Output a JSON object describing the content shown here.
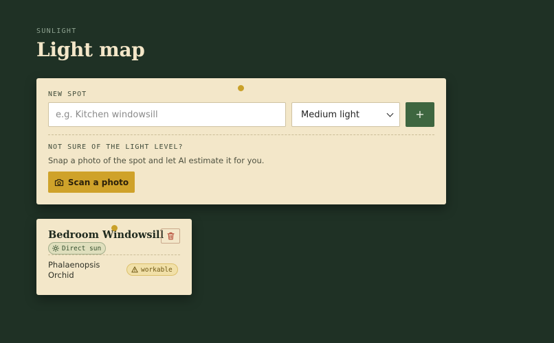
{
  "header": {
    "eyebrow": "SUNLIGHT",
    "title": "Light map"
  },
  "new_spot": {
    "label": "NEW SPOT",
    "name_placeholder": "e.g. Kitchen windowsill",
    "name_value": "",
    "light_level_selected": "Medium light",
    "add_label": "+",
    "helper_heading": "NOT SURE OF THE LIGHT LEVEL?",
    "helper_text": "Snap a photo of the spot and let AI estimate it for you.",
    "scan_label": "Scan a photo"
  },
  "spots": [
    {
      "name": "Bedroom Windowsill",
      "light": "Direct sun",
      "plants": [
        {
          "name": "Phalaenopsis Orchid",
          "status": "workable"
        }
      ]
    }
  ],
  "icons": {
    "scan": "camera-icon",
    "delete": "trash-icon",
    "light": "sun-icon",
    "status": "warning-icon",
    "select": "chevron-down-icon"
  },
  "colors": {
    "background": "#1f3125",
    "card": "#f3e7c9",
    "accent_green": "#3e6640",
    "accent_gold": "#cfa22a",
    "delete_red": "#b44a36"
  }
}
